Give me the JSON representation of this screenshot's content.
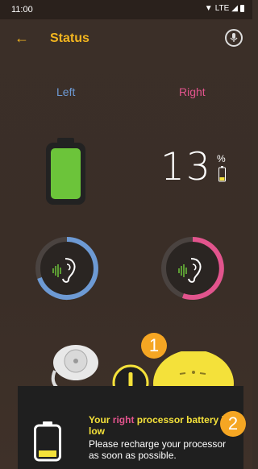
{
  "status_bar": {
    "time": "11:00",
    "network": "LTE"
  },
  "app_bar": {
    "back_icon": "arrow-left-icon",
    "title": "Status",
    "mic_icon": "mic-icon"
  },
  "sides": {
    "left_label": "Left",
    "right_label": "Right"
  },
  "right_battery": {
    "percent": "13",
    "sign": "%"
  },
  "markers": {
    "one": "1",
    "two": "2"
  },
  "toast": {
    "title_pre": "Your ",
    "title_side": "right",
    "title_post": " processor battery is low",
    "body": "Please recharge your processor as soon as possible."
  },
  "colors": {
    "accent": "#f2b51f",
    "left": "#6d9ad4",
    "right": "#e2548d",
    "battery_full": "#6cc43a",
    "battery_low": "#f4e13a",
    "marker": "#f5a623"
  }
}
